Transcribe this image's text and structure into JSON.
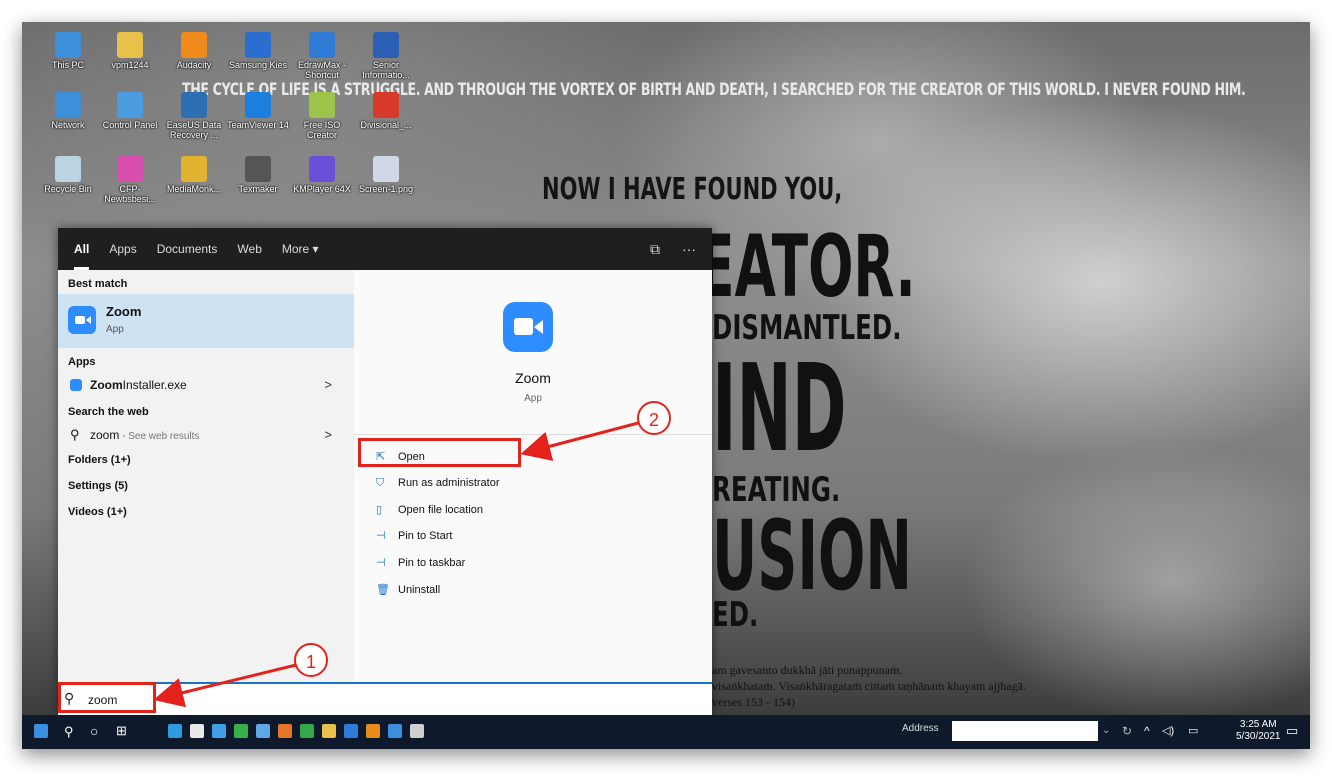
{
  "wallpaper": {
    "quote_top": "THE CYCLE OF LIFE IS A STRUGGLE. AND THROUGH THE VORTEX OF BIRTH AND DEATH, I SEARCHED FOR THE CREATOR OF THIS WORLD. I NEVER FOUND HIM.",
    "line1": "NOW I HAVE FOUND YOU,",
    "line2": "THE CREATOR.",
    "line3": "DISMANTLED.",
    "line4": "IND",
    "line5": "REATING.",
    "line6": "USION",
    "line7": "ED.",
    "pali1": "am gavesanto dukkhā jāti punappunaṁ.",
    "pali2": "visaṅkhataṁ. Visaṅkhāragataṁ cittaṁ taṇhānaṁ khayam ajjhagā.",
    "pali3": "verses 153 - 154)"
  },
  "desktop_icons": [
    {
      "label": "This PC",
      "color": "#3c8fd8"
    },
    {
      "label": "vpm1244",
      "color": "#e8c14a"
    },
    {
      "label": "Audacity",
      "color": "#f08a1c"
    },
    {
      "label": "Samsung Kies",
      "color": "#2a6fd0"
    },
    {
      "label": "EdrawMax - Shortcut",
      "color": "#2f7bd6"
    },
    {
      "label": "Senior Informatio...",
      "color": "#2b5fb4"
    },
    {
      "label": "Network",
      "color": "#3c8fd8"
    },
    {
      "label": "Control Panel",
      "color": "#4a9be0"
    },
    {
      "label": "EaseUS Data Recovery ...",
      "color": "#2d6fb3"
    },
    {
      "label": "TeamViewer 14",
      "color": "#1b7fe0"
    },
    {
      "label": "Free ISO Creator",
      "color": "#9ec34a"
    },
    {
      "label": "Divisional_...",
      "color": "#d83a2a"
    },
    {
      "label": "Recycle Bin",
      "color": "#bcd3e4"
    },
    {
      "label": "CFP-Newbsbesi...",
      "color": "#d84fb0"
    },
    {
      "label": "MediaMonk...",
      "color": "#e0b230"
    },
    {
      "label": "Texmaker",
      "color": "#555555"
    },
    {
      "label": "KMPlayer 64X",
      "color": "#6a4fd8"
    },
    {
      "label": "Screen-1.png",
      "color": "#d0d8e8"
    }
  ],
  "start_menu": {
    "tabs": [
      "All",
      "Apps",
      "Documents",
      "Web",
      "More ▾"
    ],
    "tab_icons": [
      "feedback-icon",
      "more-options-icon"
    ],
    "best_match_heading": "Best match",
    "best_match": {
      "name": "Zoom",
      "type": "App"
    },
    "apps_heading": "Apps",
    "apps": [
      {
        "name_bold": "Zoom",
        "name_rest": "Installer.exe"
      }
    ],
    "web_heading": "Search the web",
    "web_result": {
      "query": "zoom",
      "suffix": " - See web results"
    },
    "other_sections": [
      "Folders (1+)",
      "Settings (5)",
      "Videos (1+)"
    ],
    "detail": {
      "name": "Zoom",
      "type": "App"
    },
    "actions": [
      {
        "label": "Open",
        "icon": "open-icon"
      },
      {
        "label": "Run as administrator",
        "icon": "admin-icon"
      },
      {
        "label": "Open file location",
        "icon": "folder-icon"
      },
      {
        "label": "Pin to Start",
        "icon": "pin-icon"
      },
      {
        "label": "Pin to taskbar",
        "icon": "pin-icon"
      },
      {
        "label": "Uninstall",
        "icon": "trash-icon"
      }
    ]
  },
  "search_box": {
    "value": "zoom"
  },
  "taskbar": {
    "address_label": "Address",
    "time": "3:25 AM",
    "date": "5/30/2021"
  },
  "annotations": {
    "badge1": "1",
    "badge2": "2",
    "color": "#e3231b"
  }
}
